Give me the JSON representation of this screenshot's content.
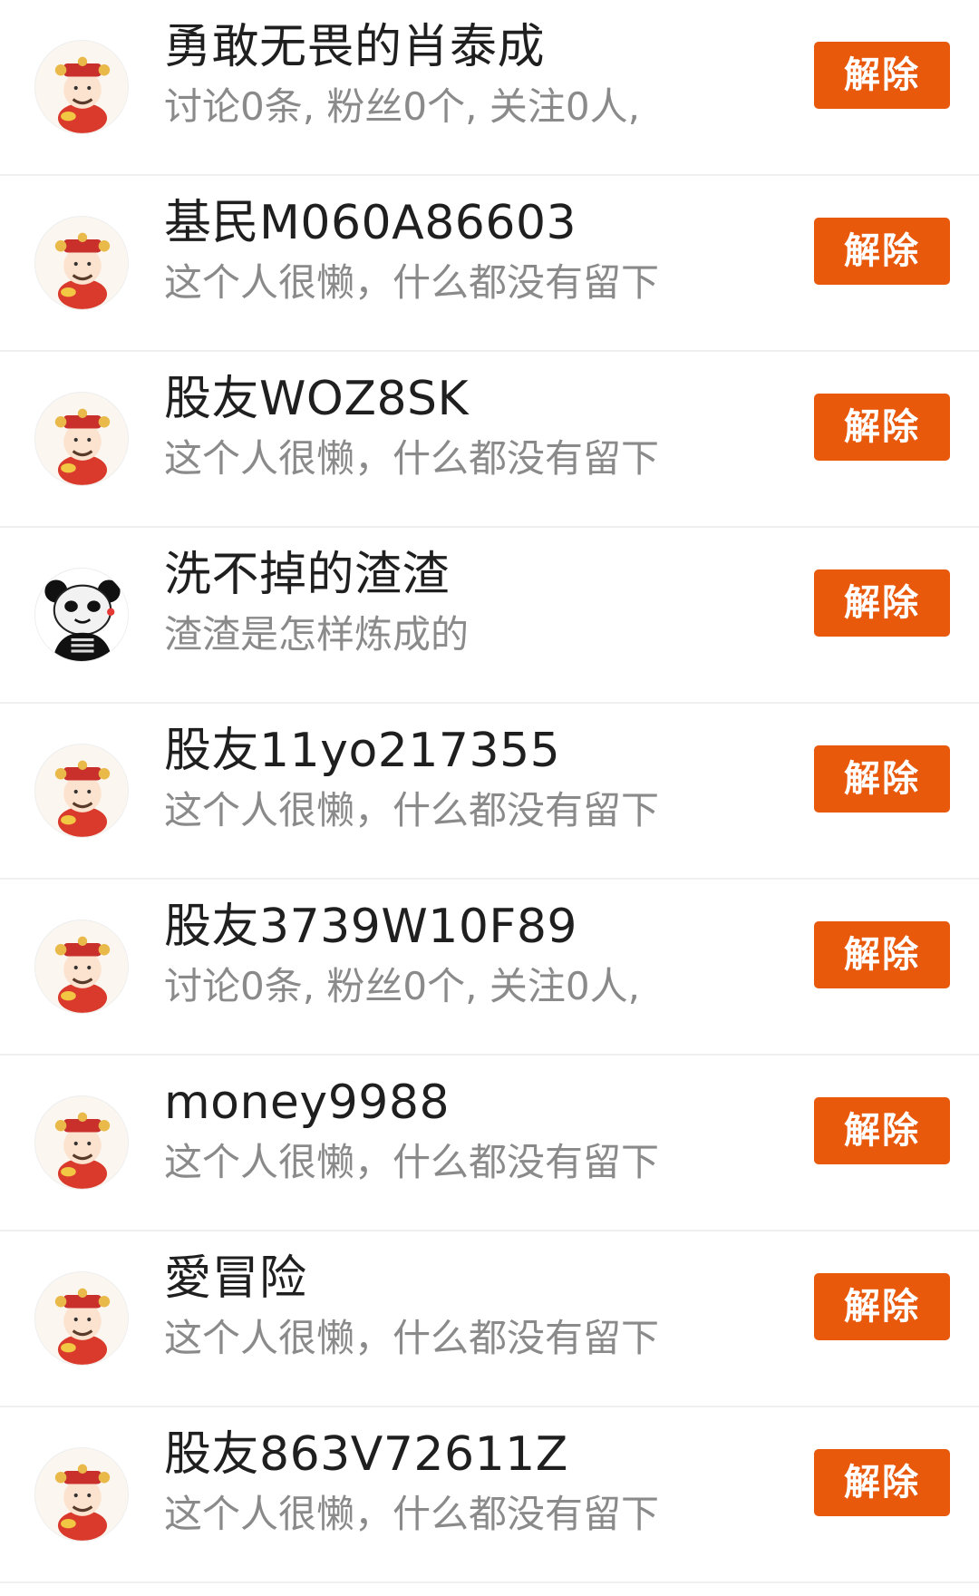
{
  "accent_color": "#e8590c",
  "items": [
    {
      "name": "勇敢无畏的肖泰成",
      "description": "讨论0条, 粉丝0个, 关注0人,",
      "avatar": "caishen-avatar-icon",
      "action_label": "解除"
    },
    {
      "name": "基民M060A86603",
      "description": "这个人很懒，什么都没有留下",
      "avatar": "caishen-avatar-icon",
      "action_label": "解除"
    },
    {
      "name": "股友WOZ8SK",
      "description": "这个人很懒，什么都没有留下",
      "avatar": "caishen-avatar-icon",
      "action_label": "解除"
    },
    {
      "name": "洗不掉的渣渣",
      "description": "渣渣是怎样炼成的",
      "avatar": "panda-meme-avatar-icon",
      "action_label": "解除"
    },
    {
      "name": "股友11yo217355",
      "description": "这个人很懒，什么都没有留下",
      "avatar": "caishen-avatar-icon",
      "action_label": "解除"
    },
    {
      "name": "股友3739W10F89",
      "description": "讨论0条, 粉丝0个, 关注0人,",
      "avatar": "caishen-avatar-icon",
      "action_label": "解除"
    },
    {
      "name": "money9988",
      "description": "这个人很懒，什么都没有留下",
      "avatar": "caishen-avatar-icon",
      "action_label": "解除"
    },
    {
      "name": "愛冒险",
      "description": "这个人很懒，什么都没有留下",
      "avatar": "caishen-avatar-icon",
      "action_label": "解除"
    },
    {
      "name": "股友863V72611Z",
      "description": "这个人很懒，什么都没有留下",
      "avatar": "caishen-avatar-icon",
      "action_label": "解除"
    }
  ]
}
